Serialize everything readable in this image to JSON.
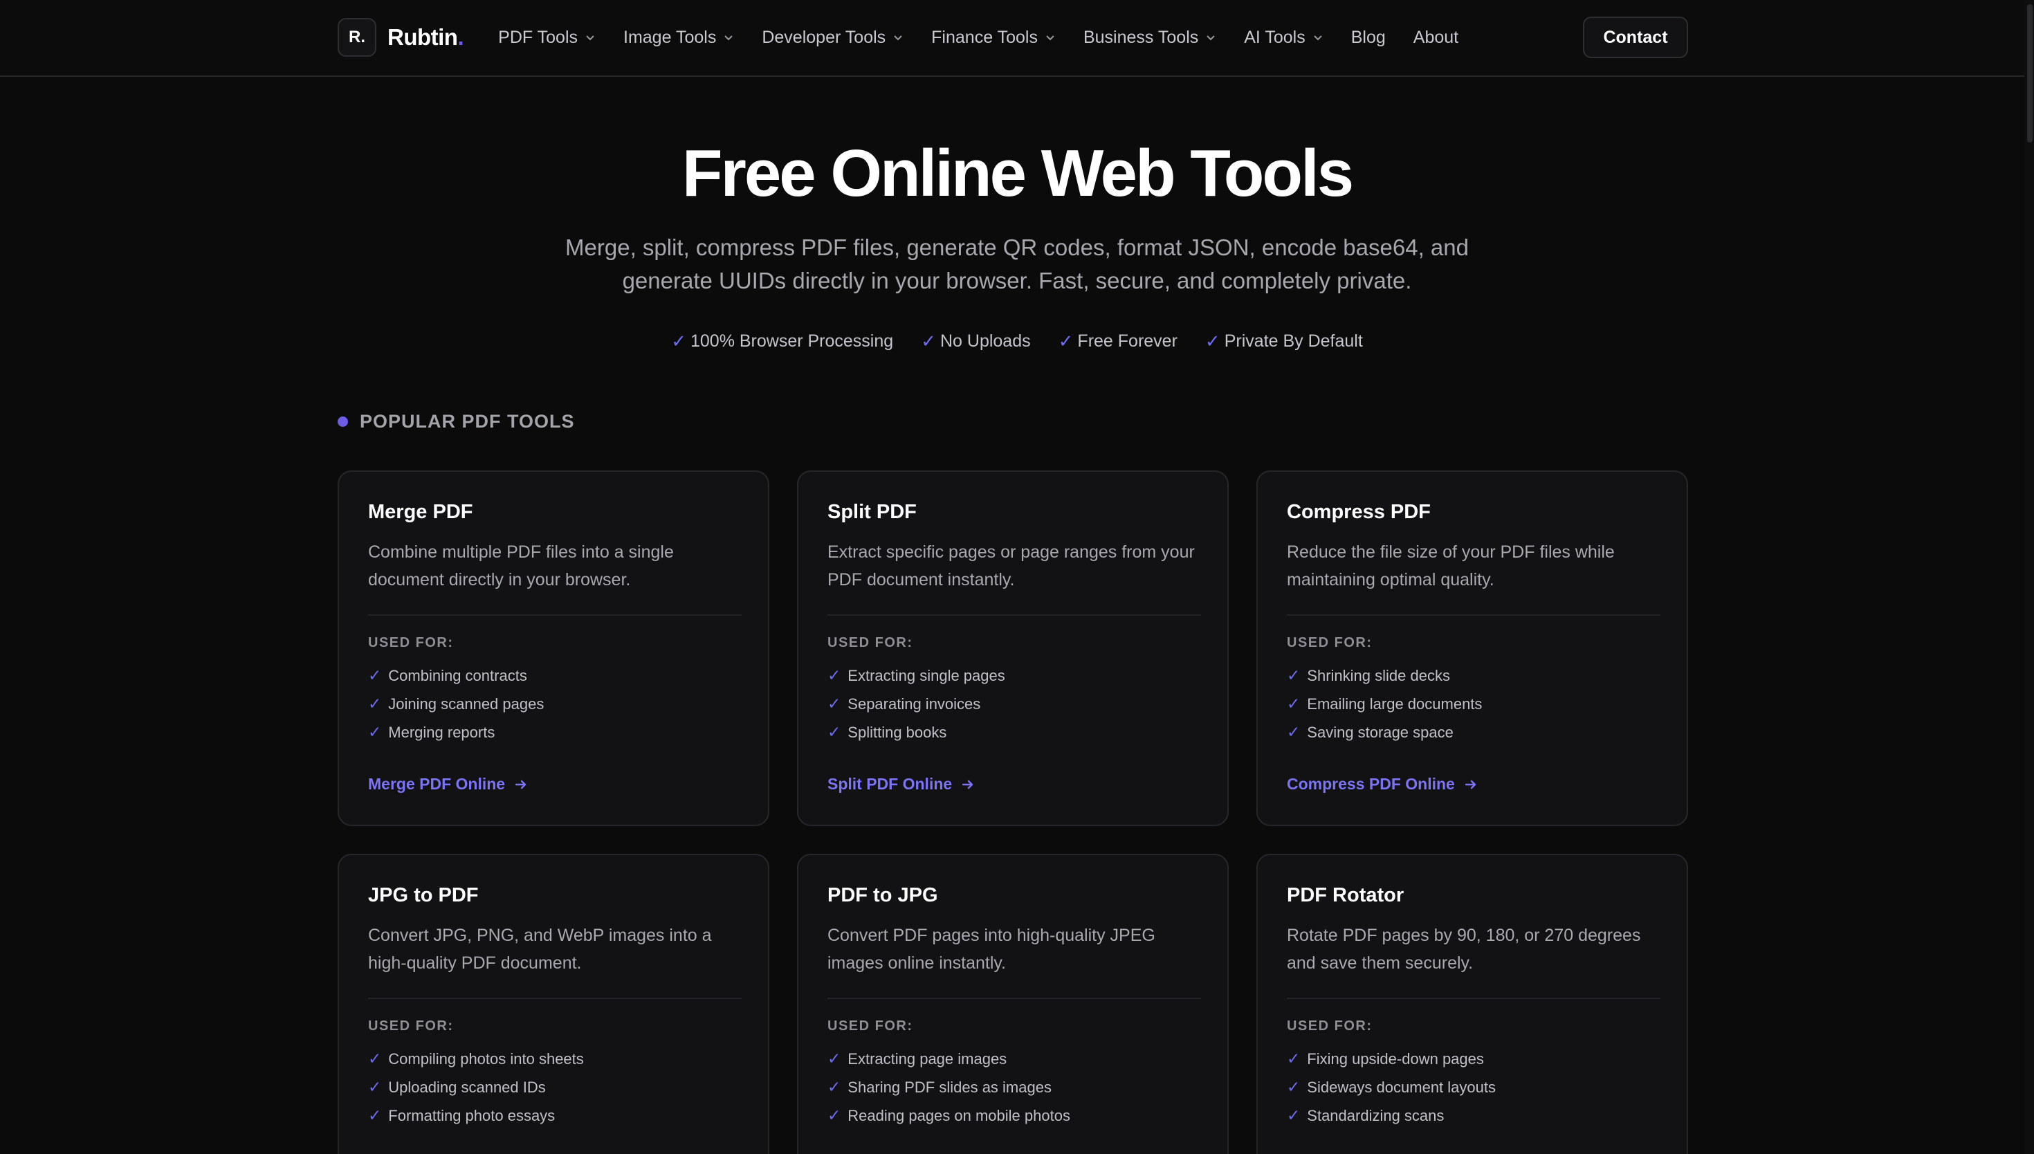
{
  "header": {
    "logo_mark": "R.",
    "logo_name": "Rubtin",
    "logo_dot": ".",
    "nav": [
      {
        "label": "PDF Tools",
        "dropdown": true
      },
      {
        "label": "Image Tools",
        "dropdown": true
      },
      {
        "label": "Developer Tools",
        "dropdown": true
      },
      {
        "label": "Finance Tools",
        "dropdown": true
      },
      {
        "label": "Business Tools",
        "dropdown": true
      },
      {
        "label": "AI Tools",
        "dropdown": true
      },
      {
        "label": "Blog",
        "dropdown": false
      },
      {
        "label": "About",
        "dropdown": false
      }
    ],
    "contact_label": "Contact"
  },
  "hero": {
    "title": "Free Online Web Tools",
    "subtitle": "Merge, split, compress PDF files, generate QR codes, format JSON, encode base64, and generate UUIDs directly in your browser. Fast, secure, and completely private.",
    "badges": [
      "100% Browser Processing",
      "No Uploads",
      "Free Forever",
      "Private By Default"
    ]
  },
  "section": {
    "label": "POPULAR PDF TOOLS"
  },
  "used_for_label": "USED FOR:",
  "cards": [
    {
      "title": "Merge PDF",
      "desc": "Combine multiple PDF files into a single document directly in your browser.",
      "uses": [
        "Combining contracts",
        "Joining scanned pages",
        "Merging reports"
      ],
      "link": "Merge PDF Online"
    },
    {
      "title": "Split PDF",
      "desc": "Extract specific pages or page ranges from your PDF document instantly.",
      "uses": [
        "Extracting single pages",
        "Separating invoices",
        "Splitting books"
      ],
      "link": "Split PDF Online"
    },
    {
      "title": "Compress PDF",
      "desc": "Reduce the file size of your PDF files while maintaining optimal quality.",
      "uses": [
        "Shrinking slide decks",
        "Emailing large documents",
        "Saving storage space"
      ],
      "link": "Compress PDF Online"
    },
    {
      "title": "JPG to PDF",
      "desc": "Convert JPG, PNG, and WebP images into a high-quality PDF document.",
      "uses": [
        "Compiling photos into sheets",
        "Uploading scanned IDs",
        "Formatting photo essays"
      ],
      "link": ""
    },
    {
      "title": "PDF to JPG",
      "desc": "Convert PDF pages into high-quality JPEG images online instantly.",
      "uses": [
        "Extracting page images",
        "Sharing PDF slides as images",
        "Reading pages on mobile photos"
      ],
      "link": ""
    },
    {
      "title": "PDF Rotator",
      "desc": "Rotate PDF pages by 90, 180, or 270 degrees and save them securely.",
      "uses": [
        "Fixing upside-down pages",
        "Sideways document layouts",
        "Standardizing scans"
      ],
      "link": ""
    }
  ],
  "colors": {
    "background": "#0b0b0c",
    "card_bg": "#121214",
    "accent": "#6c5ce7",
    "link": "#7b74f5",
    "check": "#6c6cf0"
  },
  "icons": {
    "nav_dropdown": "chevron-down-icon",
    "badge": "check-icon",
    "link": "arrow-right-icon"
  }
}
